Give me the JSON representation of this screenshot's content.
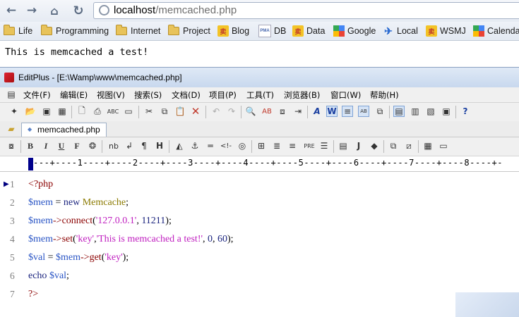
{
  "browser": {
    "url_host": "localhost",
    "url_path": "/memcached.php",
    "bookmarks": [
      {
        "label": "Life",
        "icon": "folder-icon"
      },
      {
        "label": "Programming",
        "icon": "folder-icon"
      },
      {
        "label": "Internet",
        "icon": "folder-icon"
      },
      {
        "label": "Project",
        "icon": "folder-icon"
      },
      {
        "label": "Blog",
        "icon": "yellow-fav-icon"
      },
      {
        "label": "DB",
        "icon": "phpmyadmin-icon"
      },
      {
        "label": "Data",
        "icon": "yellow-fav-icon"
      },
      {
        "label": "Google",
        "icon": "google-icon"
      },
      {
        "label": "Local",
        "icon": "local-icon"
      },
      {
        "label": "WSMJ",
        "icon": "yellow-fav-icon"
      },
      {
        "label": "Calendar",
        "icon": "google-icon"
      }
    ],
    "page_text": "This is memcached a test!"
  },
  "editor": {
    "title": "EditPlus - [E:\\Wamp\\www\\memcached.php]",
    "menu": [
      "文件(F)",
      "编辑(E)",
      "视图(V)",
      "搜索(S)",
      "文档(D)",
      "项目(P)",
      "工具(T)",
      "浏览器(B)",
      "窗口(W)",
      "帮助(H)"
    ],
    "tab_label": "memcached.php",
    "ruler": "---+----1----+----2----+----3----+----4----+----5----+----6----+----7----+----8----+-",
    "line_numbers": [
      "1",
      "2",
      "3",
      "4",
      "5",
      "6",
      "7"
    ],
    "code": {
      "l1": {
        "open_tag": "<?php"
      },
      "l2": {
        "var": "$mem",
        "eq": " = ",
        "kw": "new",
        "cls": " Memcache",
        "end": ";"
      },
      "l3": {
        "var": "$mem",
        "arrow": "->",
        "fn": "connect",
        "p1": "(",
        "str": "'127.0.0.1'",
        "comma": ", ",
        "num": "11211",
        "end": ");"
      },
      "l4": {
        "var": "$mem",
        "arrow": "->",
        "fn": "set",
        "p1": "(",
        "str1": "'key'",
        "comma1": ",",
        "str2": "'This is memcached a test!'",
        "comma2": ", ",
        "num1": "0",
        "comma3": ", ",
        "num2": "60",
        "end": ");"
      },
      "l5": {
        "var1": "$val",
        "eq": " = ",
        "var2": "$mem",
        "arrow": "->",
        "fn": "get",
        "p1": "(",
        "str": "'key'",
        "end": ");"
      },
      "l6": {
        "kw": "echo",
        "sp": " ",
        "var": "$val",
        "end": ";"
      },
      "l7": {
        "close_tag": "?>"
      }
    }
  },
  "colors": {
    "php_tag": "#8b0000",
    "variable": "#2a55c5",
    "string": "#c020c0",
    "keyword": "#1a237e",
    "class": "#8b7a00",
    "line_number": "#808080"
  }
}
